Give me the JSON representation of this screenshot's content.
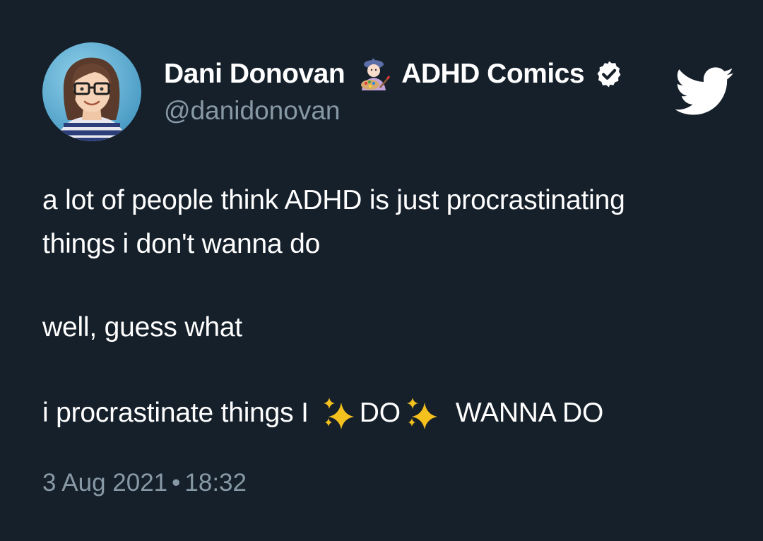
{
  "author": {
    "display_name": "Dani Donovan",
    "emoji": "artist-emoji",
    "tag": "ADHD Comics",
    "verified": true,
    "handle": "@danidonovan"
  },
  "tweet": {
    "line1": "a lot of people think ADHD is just procrastinating",
    "line2": "things i don't wanna do",
    "line3": "well, guess what",
    "line4_prefix": "i procrastinate things I",
    "line4_emphasis": "DO",
    "line4_suffix": "WANNA DO"
  },
  "meta": {
    "date": "3 Aug 2021",
    "separator": "•",
    "time": "18:32"
  },
  "icons": {
    "brand": "twitter-bird-icon",
    "verified": "verified-badge-icon",
    "sparkles": "sparkles-icon"
  },
  "colors": {
    "background": "#16202b",
    "text": "#ffffff",
    "secondary_text": "#8899a6",
    "sparkle": "#f4c01e"
  }
}
